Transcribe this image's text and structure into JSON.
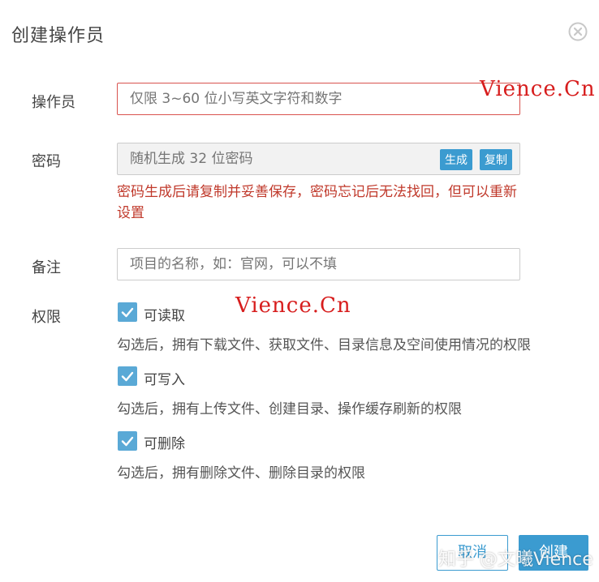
{
  "dialog": {
    "title": "创建操作员"
  },
  "form": {
    "operator": {
      "label": "操作员",
      "placeholder": "仅限 3~60 位小写英文字符和数字"
    },
    "password": {
      "label": "密码",
      "placeholder": "随机生成 32 位密码",
      "generate_label": "生成",
      "copy_label": "复制",
      "error_text": "密码生成后请复制并妥善保存，密码忘记后无法找回，但可以重新设置"
    },
    "remark": {
      "label": "备注",
      "placeholder": "项目的名称，如：官网，可以不填"
    },
    "permissions": {
      "label": "权限",
      "items": [
        {
          "label": "可读取",
          "checked": true,
          "description": "勾选后，拥有下载文件、获取文件、目录信息及空间使用情况的权限"
        },
        {
          "label": "可写入",
          "checked": true,
          "description": "勾选后，拥有上传文件、创建目录、操作缓存刷新的权限"
        },
        {
          "label": "可删除",
          "checked": true,
          "description": "勾选后，拥有删除文件、删除目录的权限"
        }
      ]
    }
  },
  "footer": {
    "cancel_label": "取消",
    "create_label": "创建"
  },
  "watermarks": {
    "top": "Vience.Cn",
    "middle": "Vience.Cn",
    "bottom": "知乎 @文曦Vience"
  },
  "colors": {
    "accent": "#3b9bd0",
    "checkbox": "#5aa9d6",
    "error": "#c0392b",
    "watermark": "#d71d1d"
  },
  "icons": {
    "close": "close-circle-icon",
    "checkbox": "checkmark-icon"
  }
}
